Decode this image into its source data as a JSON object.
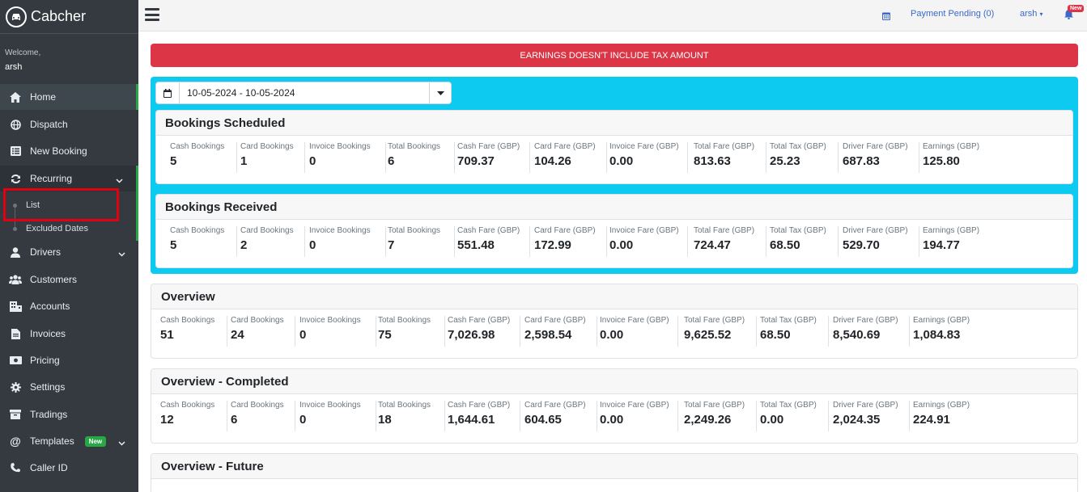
{
  "brand": {
    "name": "Cabcher"
  },
  "welcome": {
    "greeting": "Welcome,",
    "user": "arsh"
  },
  "sidebar": {
    "items": [
      {
        "label": "Home",
        "icon": "home-icon"
      },
      {
        "label": "Dispatch",
        "icon": "globe-icon"
      },
      {
        "label": "New Booking",
        "icon": "list-icon"
      },
      {
        "label": "Recurring",
        "icon": "sync-icon"
      },
      {
        "label": "Drivers",
        "icon": "user-icon"
      },
      {
        "label": "Customers",
        "icon": "users-icon"
      },
      {
        "label": "Accounts",
        "icon": "building-icon"
      },
      {
        "label": "Invoices",
        "icon": "file-icon"
      },
      {
        "label": "Pricing",
        "icon": "money-icon"
      },
      {
        "label": "Settings",
        "icon": "gear-icon"
      },
      {
        "label": "Tradings",
        "icon": "archive-icon"
      },
      {
        "label": "Templates",
        "icon": "at-icon",
        "badge": "New"
      },
      {
        "label": "Caller ID",
        "icon": "phone-icon"
      }
    ],
    "recurring_sub": [
      {
        "label": "List"
      },
      {
        "label": "Excluded Dates"
      }
    ]
  },
  "header": {
    "payment_pending": "Payment Pending (0)",
    "user": "arsh",
    "bell_badge": "New"
  },
  "alert": {
    "text": "EARNINGS DOESN'T INCLUDE TAX AMOUNT"
  },
  "date_range": {
    "value": "10-05-2024 - 10-05-2024"
  },
  "labels": [
    "Cash Bookings",
    "Card Bookings",
    "Invoice Bookings",
    "Total Bookings",
    "Cash Fare (GBP)",
    "Card Fare (GBP)",
    "Invoice Fare (GBP)",
    "Total Fare (GBP)",
    "Total Tax (GBP)",
    "Driver Fare (GBP)",
    "Earnings (GBP)"
  ],
  "sections": [
    {
      "title": "Bookings Scheduled",
      "values": [
        "5",
        "1",
        "0",
        "6",
        "709.37",
        "104.26",
        "0.00",
        "813.63",
        "25.23",
        "687.83",
        "125.80"
      ]
    },
    {
      "title": "Bookings Received",
      "values": [
        "5",
        "2",
        "0",
        "7",
        "551.48",
        "172.99",
        "0.00",
        "724.47",
        "68.50",
        "529.70",
        "194.77"
      ]
    },
    {
      "title": "Overview",
      "values": [
        "51",
        "24",
        "0",
        "75",
        "7,026.98",
        "2,598.54",
        "0.00",
        "9,625.52",
        "68.50",
        "8,540.69",
        "1,084.83"
      ]
    },
    {
      "title": "Overview - Completed",
      "values": [
        "12",
        "6",
        "0",
        "18",
        "1,644.61",
        "604.65",
        "0.00",
        "2,249.26",
        "0.00",
        "2,024.35",
        "224.91"
      ]
    },
    {
      "title": "Overview - Future",
      "values": []
    }
  ]
}
